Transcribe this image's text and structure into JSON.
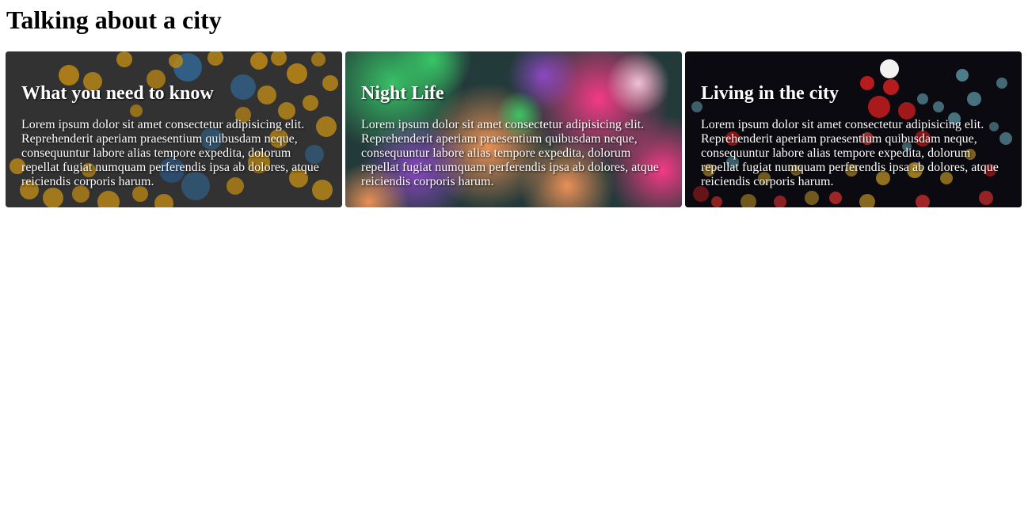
{
  "page": {
    "title": "Talking about a city"
  },
  "cards": [
    {
      "title": "What you need to know",
      "body": "Lorem ipsum dolor sit amet consectetur adipisicing elit. Reprehenderit aperiam praesentium quibusdam neque, consequuntur labore alias tempore expedita, dolorum repellat fugiat numquam perferendis ipsa ab dolores, atque reiciendis corporis harum.",
      "background": "golden-bokeh-image",
      "colors": [
        "#3a3a3a",
        "#e0a21a",
        "#3a8fd6"
      ]
    },
    {
      "title": "Night Life",
      "body": "Lorem ipsum dolor sit amet consectetur adipisicing elit. Reprehenderit aperiam praesentium quibusdam neque, consequuntur labore alias tempore expedita, dolorum repellat fugiat numquam perferendis ipsa ab dolores, atque reiciendis corporis harum.",
      "background": "colorful-bokeh-image",
      "colors": [
        "#1fa858",
        "#e02a72",
        "#f07a3a",
        "#8a3aa8"
      ]
    },
    {
      "title": "Living in the city",
      "body": "Lorem ipsum dolor sit amet consectetur adipisicing elit. Reprehenderit aperiam praesentium quibusdam neque, consequuntur labore alias tempore expedita, dolorum repellat fugiat numquam perferendis ipsa ab dolores, atque reiciendis corporis harum.",
      "background": "city-lights-bokeh-image",
      "colors": [
        "#0a0a0e",
        "#e02020",
        "#d8a82a",
        "#7ac8d8"
      ]
    }
  ]
}
